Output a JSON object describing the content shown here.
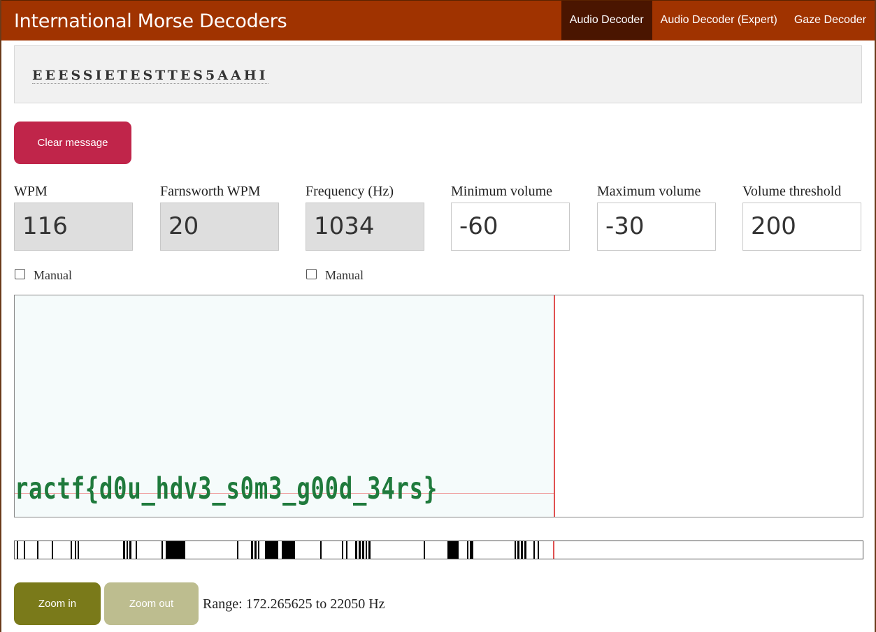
{
  "app": {
    "title": "International Morse Decoders",
    "nav": [
      {
        "label": "Audio Decoder",
        "active": true
      },
      {
        "label": "Audio Decoder (Expert)",
        "active": false
      },
      {
        "label": "Gaze Decoder",
        "active": false
      }
    ]
  },
  "message": {
    "text": "EEESSIETESTTES5AAHI"
  },
  "buttons": {
    "clear": "Clear message",
    "zoom_in": "Zoom in",
    "zoom_out": "Zoom out"
  },
  "params": [
    {
      "label": "WPM",
      "value": "116",
      "readonly": true
    },
    {
      "label": "Farnsworth WPM",
      "value": "20",
      "readonly": true
    },
    {
      "label": "Frequency (Hz)",
      "value": "1034",
      "readonly": true
    },
    {
      "label": "Minimum volume",
      "value": "-60",
      "readonly": false
    },
    {
      "label": "Maximum volume",
      "value": "-30",
      "readonly": false
    },
    {
      "label": "Volume threshold",
      "value": "200",
      "readonly": false
    }
  ],
  "manual_label": "Manual",
  "spectrogram": {
    "text": "ractf{d0u_hdv3_s0m3_g00d_34rs}"
  },
  "range": "Range: 172.265625 to 22050 Hz",
  "colors": {
    "header": "#a03300",
    "clear_button": "#c0254a",
    "zoom_in": "#7a7a1a",
    "zoom_out": "#bdbd8f"
  }
}
